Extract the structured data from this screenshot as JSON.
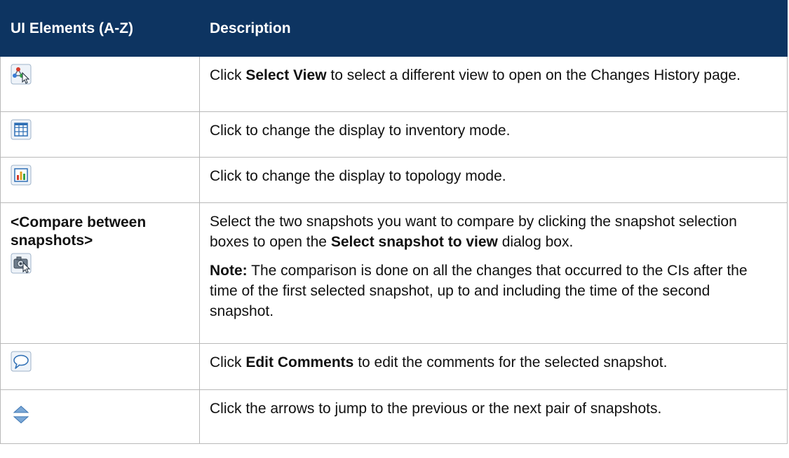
{
  "header": {
    "col_elements": "UI Elements (A-Z)",
    "col_description": "Description"
  },
  "rows": [
    {
      "icon": "select-view-icon",
      "desc": {
        "pre": "Click ",
        "bold": "Select View",
        "post": " to select a different view to open on the Changes History page."
      }
    },
    {
      "icon": "inventory-grid-icon",
      "desc": {
        "text": "Click to change the display to inventory mode."
      }
    },
    {
      "icon": "topology-chart-icon",
      "desc": {
        "text": "Click to change the display to topology mode."
      }
    },
    {
      "label": "<Compare between snapshots>",
      "icon": "compare-snapshots-icon",
      "desc": {
        "pre": "Select the two snapshots you want to compare by clicking the snapshot selection boxes to open the ",
        "bold": "Select snapshot to view",
        "post": " dialog box.",
        "note_label": "Note:",
        "note_text": " The comparison is done on all the changes that occurred to the CIs after the time of the first selected snapshot, up to and including the time of the second snapshot."
      }
    },
    {
      "icon": "edit-comments-icon",
      "desc": {
        "pre": "Click ",
        "bold": "Edit Comments",
        "post": " to edit the comments for the selected snapshot."
      }
    },
    {
      "icon": "up-down-arrows-icon",
      "desc": {
        "text": "Click the arrows to jump to the previous or the next pair of snapshots."
      }
    }
  ],
  "colors": {
    "header_bg": "#0d3461",
    "header_text": "#ffffff",
    "border": "#b9b9b9"
  }
}
